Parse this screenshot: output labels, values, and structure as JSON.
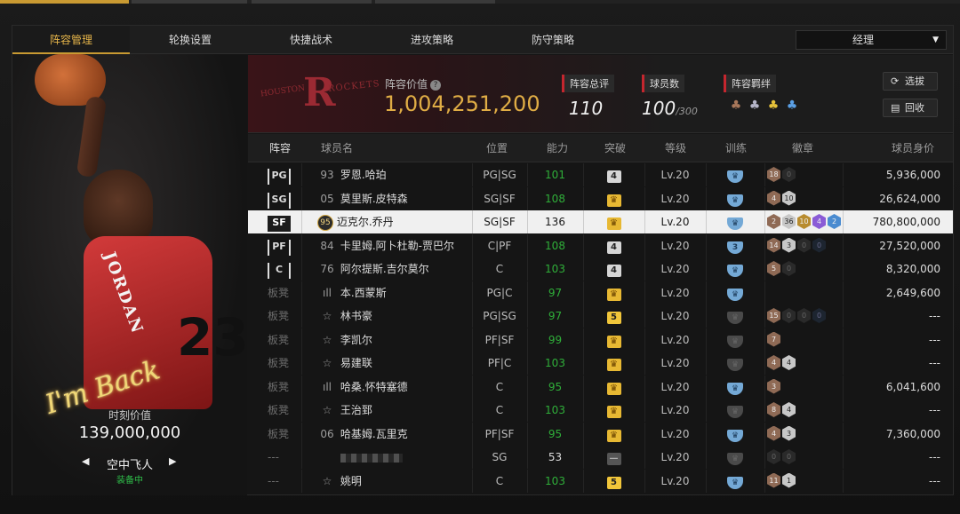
{
  "tabs": [
    {
      "label": "阵容管理",
      "active": true
    },
    {
      "label": "轮换设置",
      "active": false
    },
    {
      "label": "快捷战术",
      "active": false
    },
    {
      "label": "进攻策略",
      "active": false
    },
    {
      "label": "防守策略",
      "active": false
    }
  ],
  "mode_dropdown": {
    "value": "经理"
  },
  "player_card": {
    "jersey_text": "JORDAN",
    "jersey_number": "23",
    "signature": "I'm Back",
    "value_label": "时刻价值",
    "value": "139,000,000",
    "skill_name": "空中飞人",
    "skill_status": "装备中"
  },
  "team": {
    "logo_text_left": "HOUSTON",
    "logo_text_right": "ROCKETS",
    "value_label": "阵容价值",
    "value": "1,004,251,200",
    "rating_label": "阵容总评",
    "rating": "110",
    "count_label": "球员数",
    "count": "100",
    "count_max": "/300",
    "bond_label": "阵容羁绊",
    "bond_icons": [
      "bronze-bond-icon",
      "silver-bond-icon",
      "gold-bond-icon",
      "blue-bond-icon"
    ]
  },
  "buttons": {
    "scout": "选拔",
    "recycle": "回收"
  },
  "columns": [
    "阵容",
    "球员名",
    "位置",
    "能力",
    "突破",
    "等级",
    "训练",
    "徽章",
    "球员身价"
  ],
  "rows": [
    {
      "pos": "PG",
      "starter": true,
      "num": "93",
      "name": "罗恩.哈珀",
      "positions": "PG|SG",
      "ability": "101",
      "ability_green": true,
      "break": {
        "type": "num",
        "text": "4"
      },
      "level": "Lv.20",
      "train": {
        "type": "blue",
        "text": ""
      },
      "badges": [
        {
          "c": "bronze",
          "t": "18"
        },
        {
          "c": "dim",
          "t": "0"
        }
      ],
      "price": "5,936,000"
    },
    {
      "pos": "SG",
      "starter": true,
      "num": "05",
      "name": "莫里斯.皮特森",
      "positions": "SG|SF",
      "ability": "108",
      "ability_green": true,
      "break": {
        "type": "crown",
        "text": "♛"
      },
      "level": "Lv.20",
      "train": {
        "type": "blue",
        "text": ""
      },
      "badges": [
        {
          "c": "bronze",
          "t": "4"
        },
        {
          "c": "silver",
          "t": "10"
        }
      ],
      "price": "26,624,000"
    },
    {
      "pos": "SF",
      "starter": true,
      "selected": true,
      "num": "",
      "badge_num": "95",
      "name": "迈克尔.乔丹",
      "positions": "SG|SF",
      "ability": "136",
      "ability_green": false,
      "break": {
        "type": "crown",
        "text": "♛"
      },
      "level": "Lv.20",
      "train": {
        "type": "blue",
        "text": ""
      },
      "badges": [
        {
          "c": "bronze",
          "t": "2"
        },
        {
          "c": "silver",
          "t": "36"
        },
        {
          "c": "gold",
          "t": "10"
        },
        {
          "c": "purple",
          "t": "4"
        },
        {
          "c": "blue",
          "t": "2"
        }
      ],
      "price": "780,800,000"
    },
    {
      "pos": "PF",
      "starter": true,
      "num": "84",
      "name": "卡里姆.阿卜杜勒-贾巴尔",
      "positions": "C|PF",
      "ability": "108",
      "ability_green": true,
      "break": {
        "type": "num",
        "text": "4"
      },
      "level": "Lv.20",
      "train": {
        "type": "blue",
        "text": "3"
      },
      "badges": [
        {
          "c": "bronze",
          "t": "14"
        },
        {
          "c": "silver",
          "t": "3"
        },
        {
          "c": "dim",
          "t": "0"
        },
        {
          "c": "dimb",
          "t": "0"
        }
      ],
      "price": "27,520,000"
    },
    {
      "pos": "C",
      "starter": true,
      "num": "76",
      "name": "阿尔提斯.吉尔莫尔",
      "positions": "C",
      "ability": "103",
      "ability_green": true,
      "break": {
        "type": "num",
        "text": "4"
      },
      "level": "Lv.20",
      "train": {
        "type": "blue",
        "text": ""
      },
      "badges": [
        {
          "c": "bronze",
          "t": "5"
        },
        {
          "c": "dim",
          "t": "0"
        }
      ],
      "price": "8,320,000"
    },
    {
      "pos": "板凳",
      "starter": false,
      "num": "bars",
      "name": "本.西蒙斯",
      "positions": "PG|C",
      "ability": "97",
      "ability_green": true,
      "break": {
        "type": "crown",
        "text": "♛"
      },
      "level": "Lv.20",
      "train": {
        "type": "blue",
        "text": ""
      },
      "badges": [],
      "price": "2,649,600"
    },
    {
      "pos": "板凳",
      "starter": false,
      "num": "star",
      "name": "林书豪",
      "positions": "PG|SG",
      "ability": "97",
      "ability_green": true,
      "break": {
        "type": "gold",
        "text": "5"
      },
      "level": "Lv.20",
      "train": {
        "type": "dark",
        "text": ""
      },
      "badges": [
        {
          "c": "bronze",
          "t": "15"
        },
        {
          "c": "dim",
          "t": "0"
        },
        {
          "c": "dim",
          "t": "0"
        },
        {
          "c": "dimb",
          "t": "0"
        }
      ],
      "price": "---"
    },
    {
      "pos": "板凳",
      "starter": false,
      "num": "star",
      "name": "李凯尔",
      "positions": "PF|SF",
      "ability": "99",
      "ability_green": true,
      "break": {
        "type": "crown",
        "text": "♛"
      },
      "level": "Lv.20",
      "train": {
        "type": "dark",
        "text": ""
      },
      "badges": [
        {
          "c": "bronze",
          "t": "7"
        }
      ],
      "price": "---"
    },
    {
      "pos": "板凳",
      "starter": false,
      "num": "star",
      "name": "易建联",
      "positions": "PF|C",
      "ability": "103",
      "ability_green": true,
      "break": {
        "type": "crown",
        "text": "♛"
      },
      "level": "Lv.20",
      "train": {
        "type": "dark",
        "text": ""
      },
      "badges": [
        {
          "c": "bronze",
          "t": "4"
        },
        {
          "c": "silver",
          "t": "4"
        }
      ],
      "price": "---"
    },
    {
      "pos": "板凳",
      "starter": false,
      "num": "bars",
      "name": "哈桑.怀特塞德",
      "positions": "C",
      "ability": "95",
      "ability_green": true,
      "break": {
        "type": "crown",
        "text": "♛"
      },
      "level": "Lv.20",
      "train": {
        "type": "blue",
        "text": ""
      },
      "badges": [
        {
          "c": "bronze",
          "t": "3"
        }
      ],
      "price": "6,041,600"
    },
    {
      "pos": "板凳",
      "starter": false,
      "num": "star",
      "name": "王治郅",
      "positions": "C",
      "ability": "103",
      "ability_green": true,
      "break": {
        "type": "crown",
        "text": "♛"
      },
      "level": "Lv.20",
      "train": {
        "type": "dark",
        "text": ""
      },
      "badges": [
        {
          "c": "bronze",
          "t": "8"
        },
        {
          "c": "silver",
          "t": "4"
        }
      ],
      "price": "---"
    },
    {
      "pos": "板凳",
      "starter": false,
      "num": "06",
      "name": "哈基姆.瓦里克",
      "positions": "PF|SF",
      "ability": "95",
      "ability_green": true,
      "break": {
        "type": "crown",
        "text": "♛"
      },
      "level": "Lv.20",
      "train": {
        "type": "blue",
        "text": ""
      },
      "badges": [
        {
          "c": "bronze",
          "t": "4"
        },
        {
          "c": "silver",
          "t": "3"
        }
      ],
      "price": "7,360,000"
    },
    {
      "pos": "---",
      "starter": false,
      "num": "",
      "name": "",
      "blurred": true,
      "positions": "SG",
      "ability": "53",
      "ability_green": false,
      "break": {
        "type": "dash",
        "text": "—"
      },
      "level": "Lv.20",
      "train": {
        "type": "dark",
        "text": ""
      },
      "badges": [
        {
          "c": "dim",
          "t": "0"
        },
        {
          "c": "dim",
          "t": "0"
        }
      ],
      "price": "---"
    },
    {
      "pos": "---",
      "starter": false,
      "num": "star",
      "name": "姚明",
      "positions": "C",
      "ability": "103",
      "ability_green": true,
      "break": {
        "type": "gold",
        "text": "5"
      },
      "level": "Lv.20",
      "train": {
        "type": "blue",
        "text": ""
      },
      "badges": [
        {
          "c": "bronze",
          "t": "11"
        },
        {
          "c": "silver",
          "t": "1"
        }
      ],
      "price": "---"
    }
  ]
}
